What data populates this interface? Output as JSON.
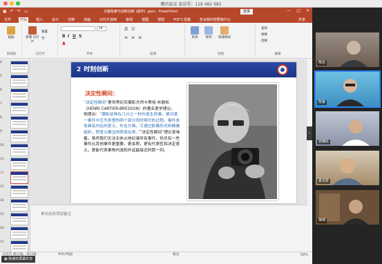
{
  "meeting": {
    "window_title": "腾讯会议 会议号：118 482 982",
    "share_banner": "陈睿的屏幕共享",
    "participants": [
      {
        "name": "陶治"
      },
      {
        "name": "陈睿"
      },
      {
        "name": "张静民"
      },
      {
        "name": "夏清泉"
      },
      {
        "name": "熊琦"
      }
    ]
  },
  "ppt": {
    "doc_title": "文献检索与创新创新 (操作) .pptx - PowerPoint",
    "login": "登录",
    "window_controls": [
      "—",
      "□",
      "✕"
    ],
    "tabs": [
      {
        "label": "文件"
      },
      {
        "label": "开始",
        "active": true
      },
      {
        "label": "插入"
      },
      {
        "label": "设计"
      },
      {
        "label": "切换"
      },
      {
        "label": "动画"
      },
      {
        "label": "幻灯片放映"
      },
      {
        "label": "审阅"
      },
      {
        "label": "视图"
      },
      {
        "label": "帮助"
      },
      {
        "label": "PDF工具箱"
      },
      {
        "label": "告诉我你想要做什么"
      }
    ],
    "share": "共享",
    "ribbon": {
      "paste": "粘贴",
      "new_slide": "新建\n幻灯片",
      "reset": "重置",
      "section": "节",
      "font_name": "",
      "font_size": "24",
      "shapes": "形状",
      "arrange": "排列",
      "quick_styles": "快速样式",
      "find": "查找",
      "replace": "替换",
      "select": "选择",
      "groups": [
        "剪贴板",
        "幻灯片",
        "字体",
        "段落",
        "绘图",
        "编辑"
      ]
    },
    "thumbnails": [
      {
        "num": "4"
      },
      {
        "num": "5"
      },
      {
        "num": "6"
      },
      {
        "num": "7"
      },
      {
        "num": "8"
      },
      {
        "num": "9"
      },
      {
        "num": "10"
      },
      {
        "num": "11"
      },
      {
        "num": "12",
        "selected": true
      },
      {
        "num": "13"
      },
      {
        "num": "14"
      },
      {
        "num": "15"
      },
      {
        "num": "16"
      },
      {
        "num": "17"
      }
    ],
    "slide": {
      "number": "2",
      "title": "时刻创新",
      "subtitle": "决定性瞬间：",
      "para1_quote": "“决定性瞬间”",
      "para1_rest": "是世界纪实摄影大师卡蒂埃-布勒松（HENRI CARTIER-BRESSON）的著名美学理论。",
      "para2_lead": "他提出：",
      "para2_quote": "“摄影这种在几分之一秒内发生的事，是对某一事件中互为表里的两个部分同时辨识的过程。事件本身具有内在的意义、外在方面，又透过影像形式的精确组织，把意义确当地表现出来。”",
      "para2_rest": "“决定性瞬间”理论意味着，虽然我们无法无休止地纪录所有事件，但总有一些事件比其他事件更重要，更本质，更有代表性和决定意义，更能代表事物内涵和外延最接近的那一刻。"
    },
    "notes_placeholder": "单击此处添加备注",
    "status": {
      "slide_info": "幻灯片 第12张，共20张",
      "language": "中文(中国)",
      "notes": "备注",
      "zoom": "59%"
    }
  }
}
